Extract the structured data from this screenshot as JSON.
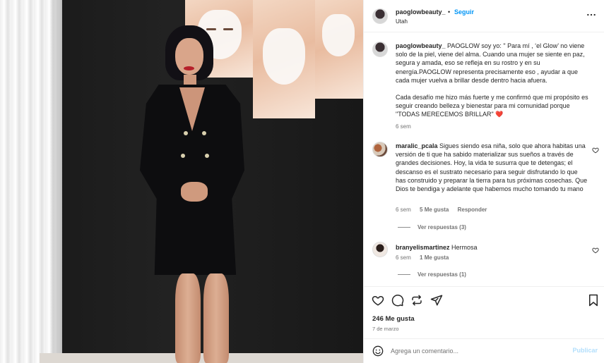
{
  "post": {
    "username": "paoglowbeauty_",
    "separator": "•",
    "follow_label": "Seguir",
    "location": "Utah"
  },
  "caption": {
    "username": "paoglowbeauty_",
    "text_p1": " PAOGLOW soy yo: \" Para mí , ‘el Glow’ no viene solo de la piel, viene del alma. Cuando una mujer se siente en paz, segura y amada, eso se refleja en su rostro y en su energía.PAOGLOW representa precisamente eso , ayudar a que cada mujer vuelva a brillar desde dentro hacia afuera.",
    "text_p2": "Cada desafío me hizo más fuerte y me confirmó que mi propósito es seguir creando belleza y bienestar para mi comunidad porque \"TODAS MERECEMOS BRILLAR\" ❤️",
    "time": "6 sem"
  },
  "comments": [
    {
      "username": "maralic_pcala",
      "text": " Sigues siendo esa niña, solo que ahora habitas una versión de ti que ha sabido materializar sus sueños a través de grandes decisiones. Hoy, la vida te susurra que te detengas; el descanso es el sustrato necesario para seguir disfrutando lo que has construido y preparar la tierra para tus próximas cosechas. Que Dios te bendiga y adelante que habemos mucho tomando tu mano",
      "time": "6 sem",
      "likes": "5 Me gusta",
      "reply_label": "Responder",
      "view_replies": "Ver respuestas (3)"
    },
    {
      "username": "branyelismartinez",
      "text": " Hermosa",
      "time": "6 sem",
      "likes": "1 Me gusta",
      "view_replies": "Ver respuestas (1)"
    }
  ],
  "actions": {
    "likes": "246 Me gusta",
    "date": "7 de marzo"
  },
  "add_comment": {
    "placeholder": "Agrega un comentario...",
    "post_label": "Publicar"
  },
  "icons": {
    "more": "more-horizontal-icon",
    "heart": "heart-icon",
    "comment": "comment-icon",
    "share": "repost-icon",
    "send": "send-icon",
    "save": "bookmark-icon",
    "emoji": "emoji-icon"
  },
  "colors": {
    "link_blue": "#0095f6",
    "post_disabled": "#b2dffc",
    "heart_red": "#e0245e",
    "muted_text": "#737373"
  }
}
